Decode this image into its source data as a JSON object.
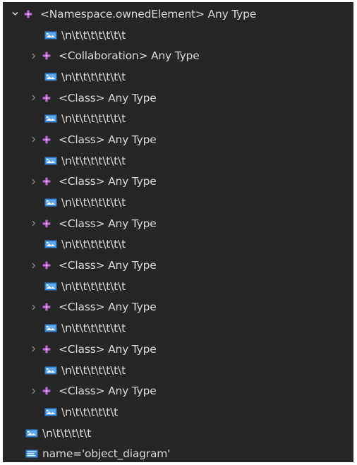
{
  "tree": {
    "root": {
      "label": "<Namespace.ownedElement> Any Type",
      "expanded": true,
      "children": [
        {
          "kind": "text",
          "label": "\\n\\t\\t\\t\\t\\t\\t\\t"
        },
        {
          "kind": "element",
          "label": "<Collaboration> Any Type",
          "expanded": false
        },
        {
          "kind": "text",
          "label": "\\n\\t\\t\\t\\t\\t\\t\\t"
        },
        {
          "kind": "element",
          "label": "<Class> Any Type",
          "expanded": false
        },
        {
          "kind": "text",
          "label": "\\n\\t\\t\\t\\t\\t\\t\\t"
        },
        {
          "kind": "element",
          "label": "<Class> Any Type",
          "expanded": false
        },
        {
          "kind": "text",
          "label": "\\n\\t\\t\\t\\t\\t\\t\\t"
        },
        {
          "kind": "element",
          "label": "<Class> Any Type",
          "expanded": false
        },
        {
          "kind": "text",
          "label": "\\n\\t\\t\\t\\t\\t\\t\\t"
        },
        {
          "kind": "element",
          "label": "<Class> Any Type",
          "expanded": false
        },
        {
          "kind": "text",
          "label": "\\n\\t\\t\\t\\t\\t\\t\\t"
        },
        {
          "kind": "element",
          "label": "<Class> Any Type",
          "expanded": false
        },
        {
          "kind": "text",
          "label": "\\n\\t\\t\\t\\t\\t\\t\\t"
        },
        {
          "kind": "element",
          "label": "<Class> Any Type",
          "expanded": false
        },
        {
          "kind": "text",
          "label": "\\n\\t\\t\\t\\t\\t\\t\\t"
        },
        {
          "kind": "element",
          "label": "<Class> Any Type",
          "expanded": false
        },
        {
          "kind": "text",
          "label": "\\n\\t\\t\\t\\t\\t\\t\\t"
        },
        {
          "kind": "element",
          "label": "<Class> Any Type",
          "expanded": false
        },
        {
          "kind": "text",
          "label": "\\n\\t\\t\\t\\t\\t\\t"
        }
      ]
    },
    "after": [
      {
        "kind": "text",
        "label": "\\n\\t\\t\\t\\t\\t"
      },
      {
        "kind": "attribute",
        "label": "name='object_diagram'"
      }
    ]
  },
  "colors": {
    "background": "#262626",
    "text": "#d9d9d9",
    "element_icon": "#c26bd6",
    "text_icon": "#2f86d8",
    "twisty": "#8a8a8a"
  },
  "icons": {
    "expanded": "chevron-down-icon",
    "collapsed": "chevron-right-icon",
    "element": "xml-element-icon",
    "text": "xml-text-node-icon",
    "attribute": "xml-attribute-icon"
  }
}
